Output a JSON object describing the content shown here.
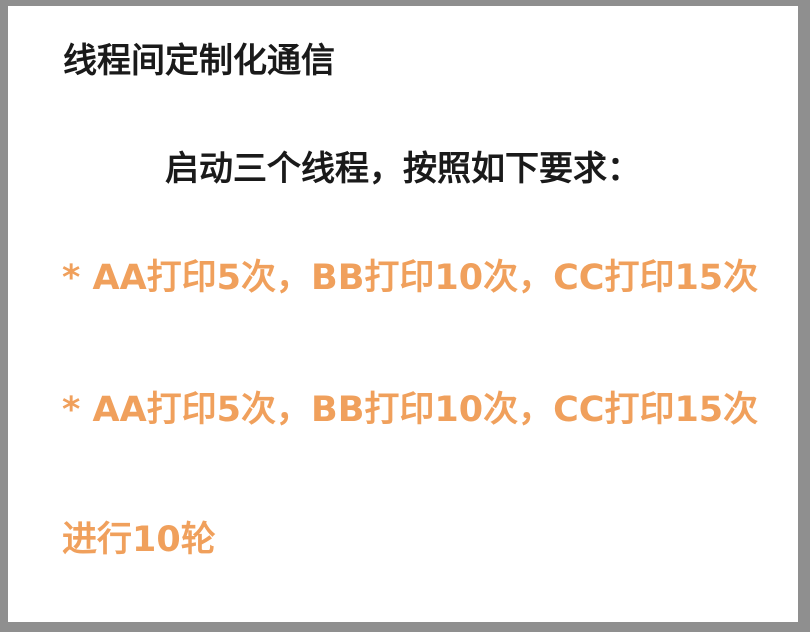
{
  "slide": {
    "title": "线程间定制化通信",
    "subtitle": "启动三个线程，按照如下要求：",
    "requirements": [
      "* AA打印5次，BB打印10次，CC打印15次",
      "* AA打印5次，BB打印10次，CC打印15次",
      "进行10轮"
    ],
    "colors": {
      "title_text": "#1a1a1a",
      "requirement_text": "#f0a05c",
      "background": "#ffffff",
      "border": "#8f8f8f"
    }
  }
}
